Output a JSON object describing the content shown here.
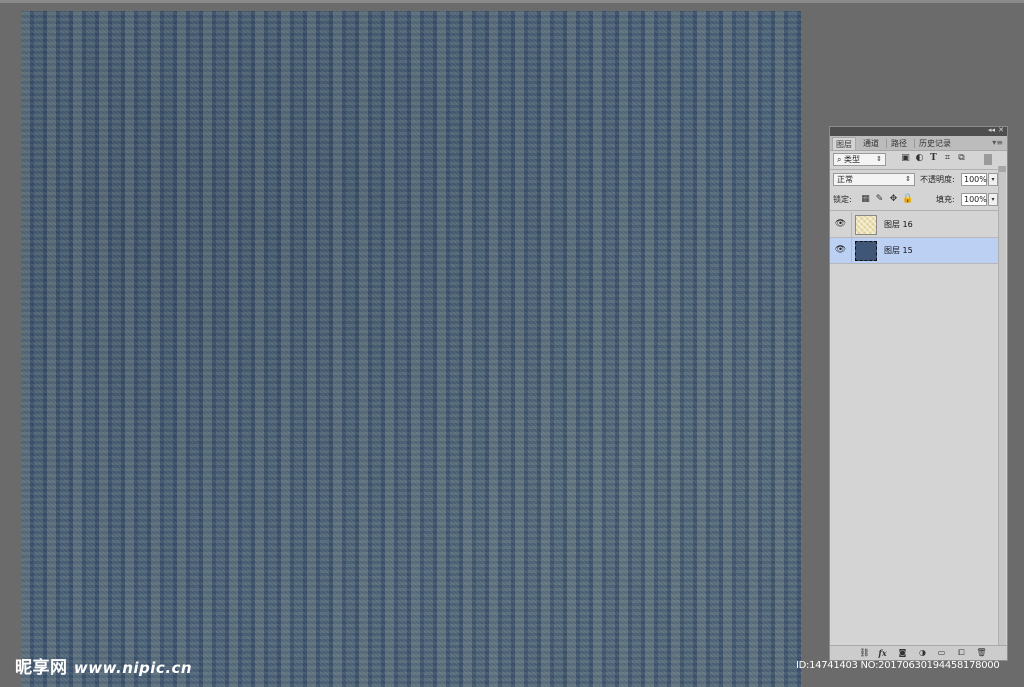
{
  "panel": {
    "tabs": [
      "图层",
      "通道",
      "路径",
      "历史记录"
    ],
    "active_tab": "图层",
    "filter": {
      "kind_label": "类型",
      "icons": [
        "image-filter-icon",
        "adjustment-filter-icon",
        "text-filter-icon",
        "shape-filter-icon",
        "smart-object-filter-icon"
      ]
    },
    "blend_mode": "正常",
    "opacity_label": "不透明度:",
    "opacity_value": "100%",
    "lock_label": "锁定:",
    "fill_label": "填充:",
    "fill_value": "100%",
    "layers": [
      {
        "name": "图层 16",
        "visible": true,
        "selected": false,
        "thumb": "yellow-pattern"
      },
      {
        "name": "图层 15",
        "visible": true,
        "selected": true,
        "thumb": "blue-denim"
      }
    ],
    "bottom_icons": [
      "link-icon",
      "fx-icon",
      "mask-icon",
      "adjustment-icon",
      "folder-icon",
      "new-layer-icon",
      "trash-icon"
    ],
    "fx_label": "fx"
  },
  "watermark": {
    "brand": "昵享网",
    "url": "www.nipic.cn"
  },
  "image_id": "ID:14741403 NO:20170630194458178000",
  "colors": {
    "canvas": "#47607c",
    "workspace": "#6b6b6b",
    "selected_layer": "#bcd0f4"
  }
}
